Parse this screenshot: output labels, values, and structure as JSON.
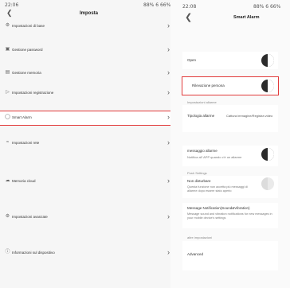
{
  "left": {
    "status_time": "22:06",
    "status_right": "88% 6 66%",
    "back_icon": "chevron-left-icon",
    "title": "Imposta",
    "items": [
      {
        "label": "Impostazioni di base",
        "icon": "gear-icon"
      },
      {
        "label": "Gestione password",
        "icon": "lock-icon"
      },
      {
        "label": "Gestione memoria",
        "icon": "storage-icon"
      },
      {
        "label": "Impostazioni registrazione",
        "icon": "record-icon"
      },
      {
        "label": "Smart Alarm",
        "icon": "alarm-icon"
      },
      {
        "label": "Impostazioni rete",
        "icon": "wifi-icon"
      },
      {
        "label": "Memoria cloud",
        "icon": "cloud-icon"
      },
      {
        "label": "Impostazioni avanzate",
        "icon": "advanced-settings-icon"
      },
      {
        "label": "Informazioni sul dispositivo",
        "icon": "info-icon"
      }
    ]
  },
  "right": {
    "status_time": "22:08",
    "status_right": "88% 6 66%",
    "title": "Smart Alarm",
    "open_label": "Open",
    "detection_label": "Rilevazione persona",
    "alarm_settings_section": "Impostazioni allarme",
    "alarm_type_label": "Tipologia allarme",
    "alarm_type_value": "Cattura immagine/Registra video",
    "alarm_message_label": "messaggio allarme",
    "alarm_message_desc": "Notifica all' APP quando c'è un allarme",
    "push_settings_label": "Push Settings",
    "dnd_label": "Non disturbare",
    "dnd_desc": "Questa funzione non accetta più messaggi di allarme dopo essere stato aperto",
    "message_notification_label": "Message Notification(Sound&Vibration)",
    "message_notification_desc": "Message sound and vibration notifications for new messages in your mobile device's settings",
    "other_settings_label": "altre impostazioni",
    "advanced_label": "Advanced"
  }
}
